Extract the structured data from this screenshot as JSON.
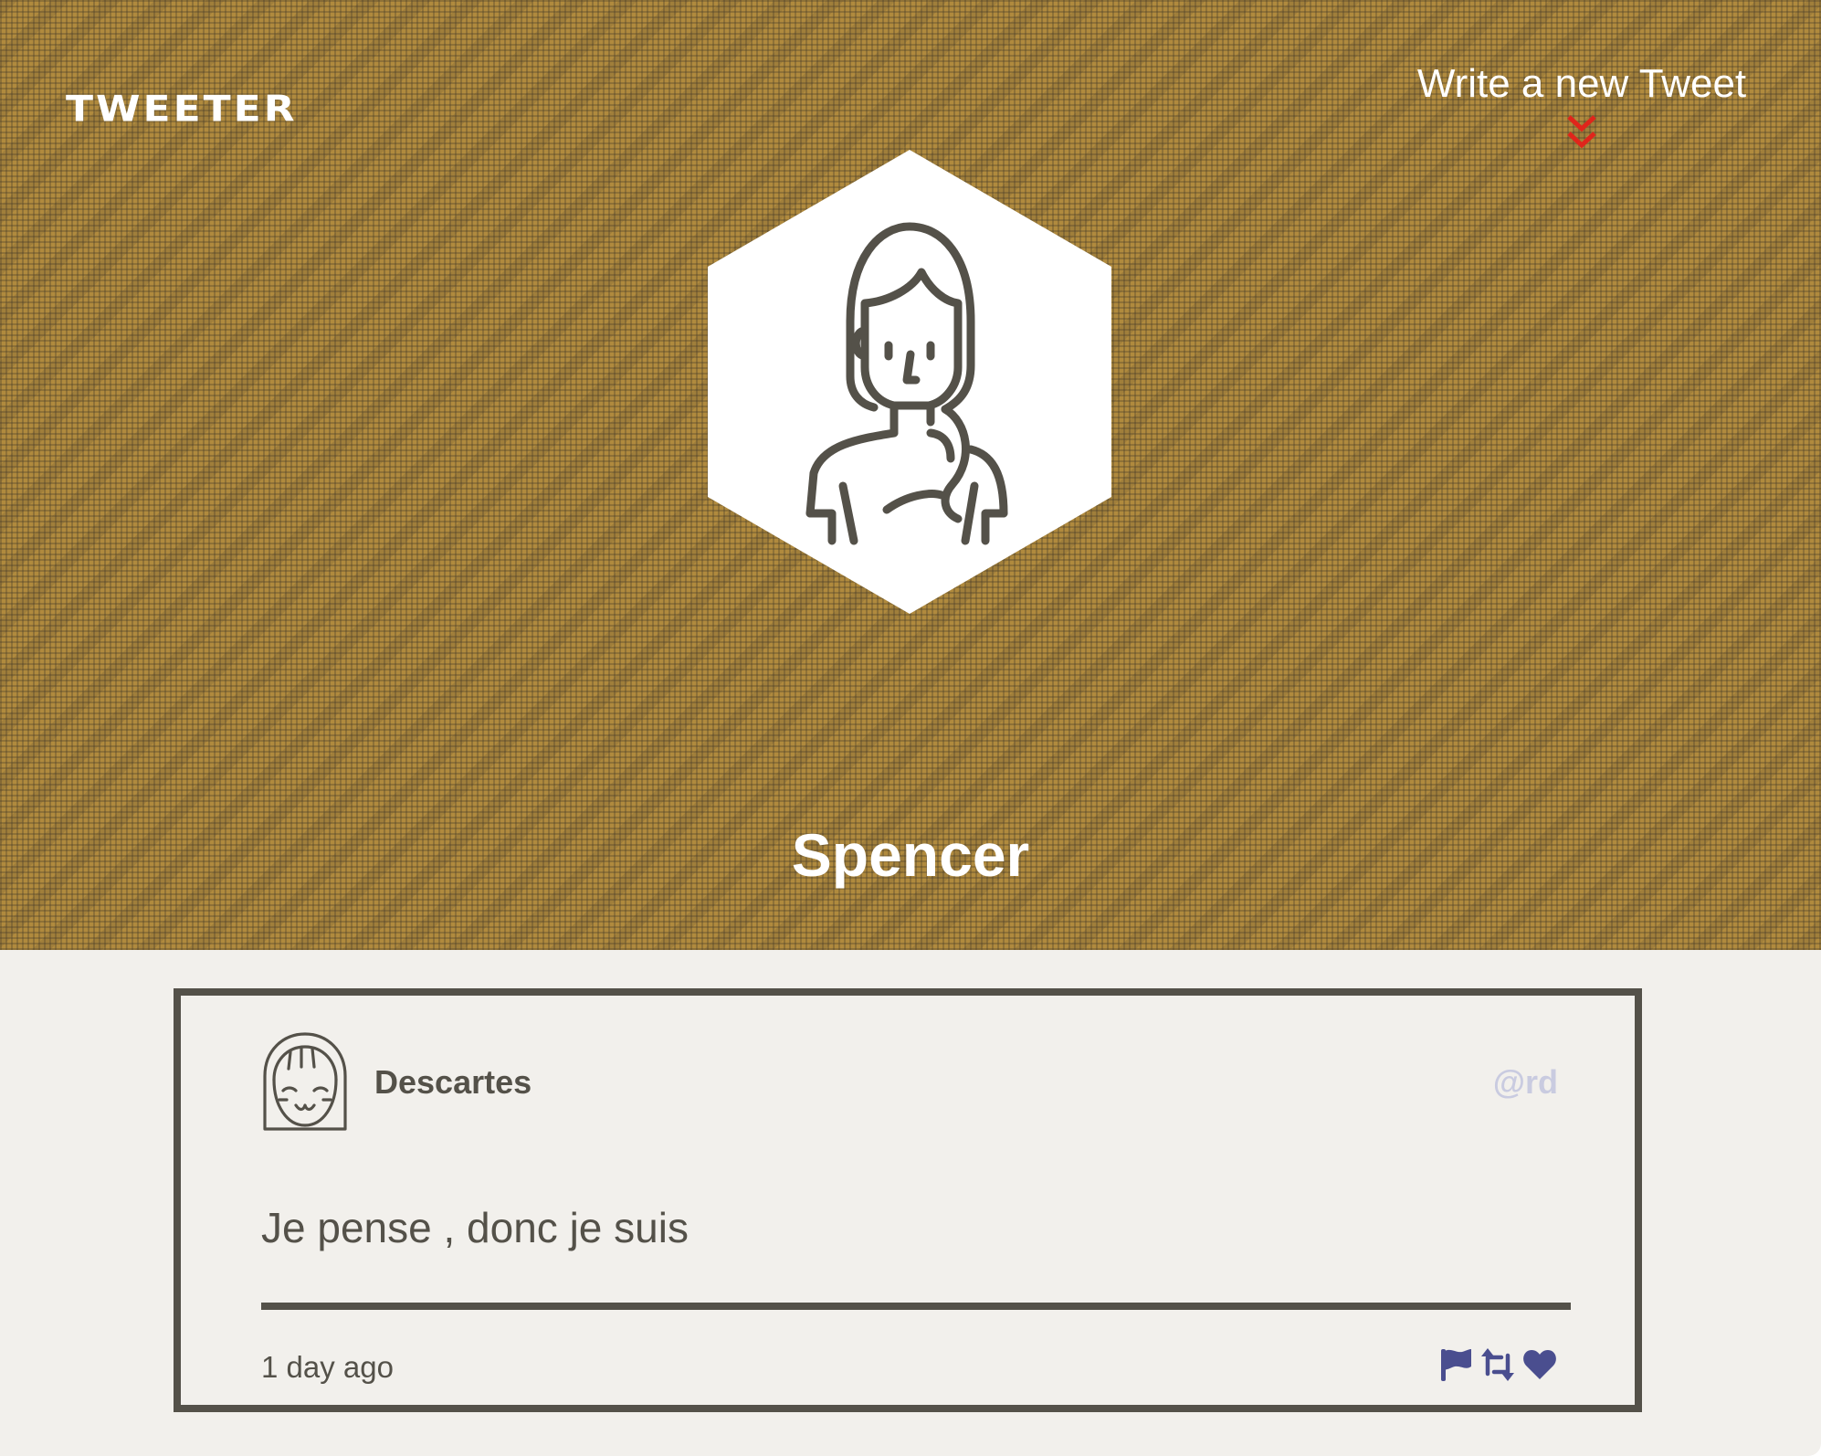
{
  "header": {
    "logo": "TWEETER",
    "compose_label": "Write a new Tweet",
    "compose_icon": "double-chevron-down-icon",
    "profile_avatar_icon": "woman-avatar-icon",
    "profile_name": "Spencer"
  },
  "tweet": {
    "avatar_icon": "girl-avatar-icon",
    "author": "Descartes",
    "handle": "@rd",
    "text": "Je pense , donc je suis",
    "timestamp": "1 day ago",
    "actions": [
      {
        "name": "flag",
        "icon": "flag-icon"
      },
      {
        "name": "retweet",
        "icon": "retweet-icon"
      },
      {
        "name": "like",
        "icon": "heart-icon"
      }
    ]
  },
  "colors": {
    "header_background": "#b08a3e",
    "page_background": "#f2f0ec",
    "text_dark": "#545149",
    "accent_red": "#e0251b",
    "action_icons": "#4a4e8f",
    "handle": "#c9cbe0"
  }
}
